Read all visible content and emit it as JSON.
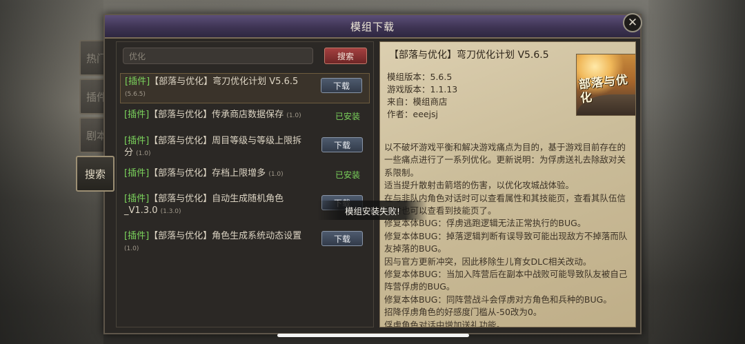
{
  "window": {
    "title": "模组下载"
  },
  "close_label": "✕",
  "side_tabs": [
    {
      "label": "热门"
    },
    {
      "label": "插件"
    },
    {
      "label": "剧本"
    },
    {
      "label": "搜索"
    }
  ],
  "search": {
    "value": "优化",
    "button_label": "搜索"
  },
  "mods": [
    {
      "tag": "[插件]",
      "name": "【部落与优化】弯刀优化计划 V5.6.5",
      "version": "(5.6.5)",
      "action": "下载"
    },
    {
      "tag": "[插件]",
      "name": "【部落与优化】传承商店数据保存",
      "version": "(1.0)",
      "action": "已安装"
    },
    {
      "tag": "[插件]",
      "name": "【部落与优化】周目等级与等级上限拆分",
      "version": "(1.0)",
      "action": "下载"
    },
    {
      "tag": "[插件]",
      "name": "【部落与优化】存档上限增多",
      "version": "(1.0)",
      "action": "已安装"
    },
    {
      "tag": "[插件]",
      "name": "【部落与优化】自动生成随机角色_V1.3.0",
      "version": "(1.3.0)",
      "action": "下载"
    },
    {
      "tag": "[插件]",
      "name": "【部落与优化】角色生成系统动态设置",
      "version": "(1.0)",
      "action": "下载"
    }
  ],
  "detail": {
    "title": "【部落与优化】弯刀优化计划 V5.6.5",
    "meta": [
      "模组版本：5.6.5",
      "游戏版本：1.1.13",
      "来自：模组商店",
      "作者：eeejsj"
    ],
    "thumb_text": "部落与优化",
    "description": [
      "以不破坏游戏平衡和解决游戏痛点为目的，基于游戏目前存在的一些痛点进行了一系列优化。更新说明：为俘虏送礼去除敌对关系限制。",
      "适当提升散射击箭塔的伤害，以优化攻城战体验。",
      "在与非队内角色对话时可以查看属性和其技能页，查看其队伍信息时也可以查看到技能页了。",
      "修复本体BUG：俘虏逃跑逻辑无法正常执行的BUG。",
      "修复本体BUG：掉落逻辑判断有误导致可能出现敌方不掉落而队友掉落的BUG。",
      "因与官方更新冲突，因此移除生儿育女DLC相关改动。",
      "修复本体BUG：当加入阵营后在副本中战败可能导致队友被自己阵营俘虏的BUG。",
      "修复本体BUG：同阵营战斗会俘虏对方角色和兵种的BUG。",
      "招降俘虏角色的好感度门槛从-50改为0。",
      "俘虏角色对话中增加送礼功能。"
    ]
  },
  "toast": "模组安装失败!"
}
